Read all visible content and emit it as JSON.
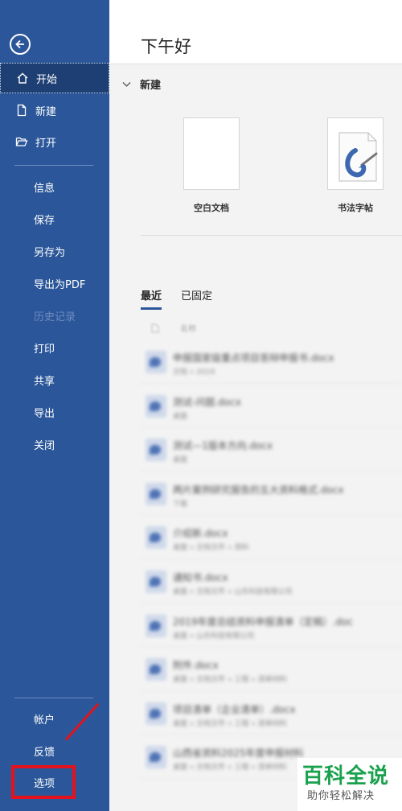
{
  "sidebar": {
    "items": [
      {
        "label": "开始",
        "icon": "home-icon"
      },
      {
        "label": "新建",
        "icon": "new-file-icon"
      },
      {
        "label": "打开",
        "icon": "folder-open-icon"
      },
      {
        "label": "信息"
      },
      {
        "label": "保存"
      },
      {
        "label": "另存为"
      },
      {
        "label": "导出为PDF"
      },
      {
        "label": "历史记录"
      },
      {
        "label": "打印"
      },
      {
        "label": "共享"
      },
      {
        "label": "导出"
      },
      {
        "label": "关闭"
      }
    ],
    "bottom": [
      {
        "label": "帐户"
      },
      {
        "label": "反馈"
      },
      {
        "label": "选项"
      }
    ]
  },
  "main": {
    "greeting": "下午好",
    "new_section": "新建",
    "templates": [
      {
        "label": "空白文档"
      },
      {
        "label": "书法字帖"
      }
    ],
    "tabs": [
      "最近",
      "已固定"
    ],
    "recent_header": "名称",
    "recent_files": [
      {
        "name": "申报国家级重点项目答辩申报书.docx",
        "sub": "文档 » 2019"
      },
      {
        "name": "测试-问题.docx",
        "sub": "桌面"
      },
      {
        "name": "测试—1版本方向.docx",
        "sub": "桌面"
      },
      {
        "name": "两片案例研究报告的五大资料格式.docx",
        "sub": "下载"
      },
      {
        "name": "介绍新.docx",
        "sub": "桌面 » 文档文件 » 资料"
      },
      {
        "name": "通知书.docx",
        "sub": "桌面 » 文档文件 » 山东科技有限公司"
      },
      {
        "name": "2019年度总结资料申报清单（定稿）.doc",
        "sub": "桌面 » 山东科技有限公司"
      },
      {
        "name": "附件.docx",
        "sub": "桌面 » 文档文件 » 工程 » 清单材料"
      },
      {
        "name": "项目清单（企业清单）.docx",
        "sub": "桌面 » 文档文件 » 工程 » 清单材料"
      },
      {
        "name": "山西省资料2025年度申报材料",
        "sub": "桌面 » 文档文件 » 工程 » 清单材料"
      }
    ]
  },
  "watermark": {
    "main": "百科全说",
    "sub": "助你轻松解决"
  },
  "colors": {
    "sidebar": "#2b579a",
    "accent": "#2b579a",
    "annotation": "#e4121c",
    "watermark": "#1aa14d"
  }
}
